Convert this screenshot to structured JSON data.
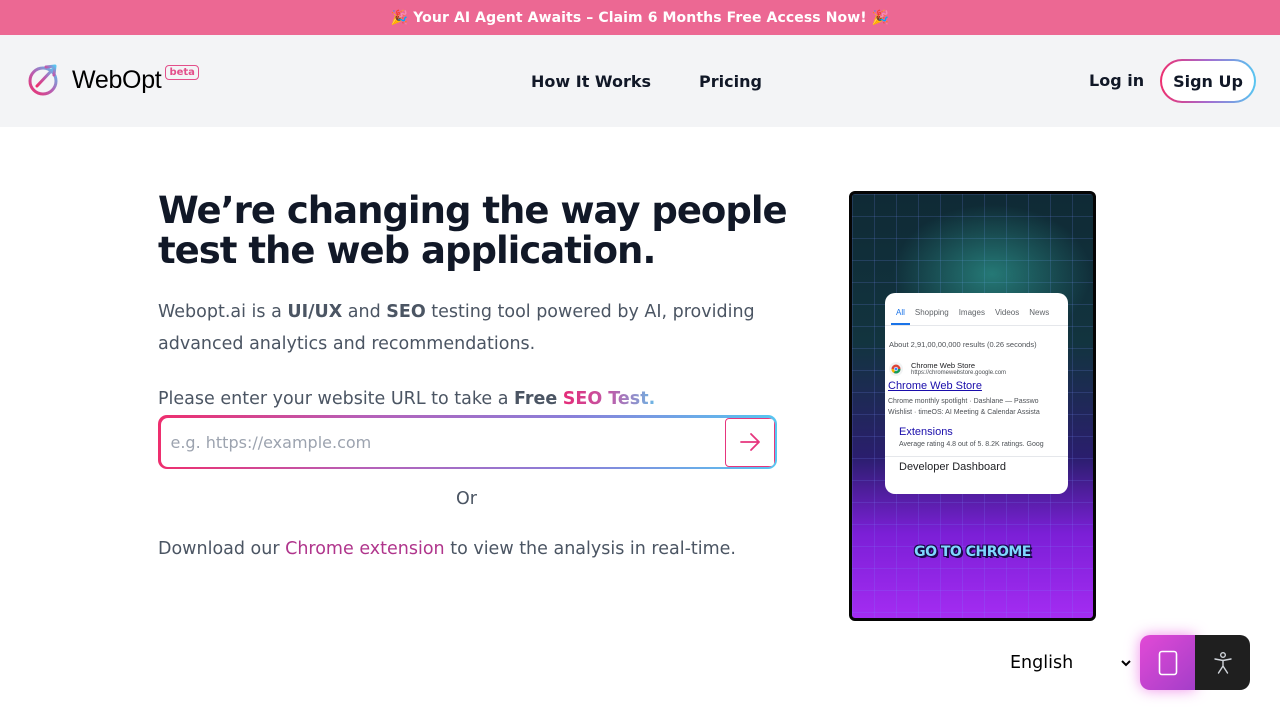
{
  "promo": {
    "text": "🎉 Your AI Agent Awaits – Claim 6 Months Free Access Now! 🎉"
  },
  "header": {
    "logo_text": "WebOpt",
    "beta_badge": "beta",
    "nav": [
      {
        "label": "How It Works"
      },
      {
        "label": "Pricing"
      }
    ],
    "login": "Log in",
    "signup": "Sign Up"
  },
  "hero": {
    "title": "We’re changing the way people test the web application.",
    "desc": {
      "p1": "Webopt.ai is a ",
      "b1": "UI/UX",
      "p2": " and ",
      "b2": "SEO",
      "p3": " testing tool powered by AI, providing advanced analytics and recommendations."
    },
    "prompt": {
      "text": "Please enter your website URL to take a ",
      "free": "Free",
      "seo_test": "SEO Test."
    },
    "url_placeholder": "e.g. https://example.com",
    "url_value": "",
    "or": "Or",
    "download": {
      "before": "Download our ",
      "link": "Chrome extension",
      "after": " to view the analysis in real-time."
    }
  },
  "preview": {
    "tabs": [
      "All",
      "Shopping",
      "Images",
      "Videos",
      "News"
    ],
    "active_tab": "All",
    "results_count": "About 2,91,00,00,000 results (0.26 seconds)",
    "site_name": "Chrome Web Store",
    "site_url": "https://chromewebstore.google.com",
    "result_title": "Chrome Web Store",
    "snippet_line1": "Chrome monthly spotlight · Dashlane — Passwo",
    "snippet_line2": "Wishlist · timeOS: AI Meeting & Calendar Assista",
    "sub1_title": "Extensions",
    "sub1_snippet": "Average rating 4.8 out of 5. 8.2K ratings. Goog",
    "sub2_title": "Developer Dashboard",
    "banner": "GO TO CHROME"
  },
  "language": {
    "selected": "English",
    "options": [
      "English"
    ]
  },
  "colors": {
    "promo_bg": "#ec6893",
    "header_bg": "#f3f4f6",
    "accent_pink": "#e62a77",
    "accent_blue": "#57c6f1",
    "link_purple": "#b0358c"
  }
}
